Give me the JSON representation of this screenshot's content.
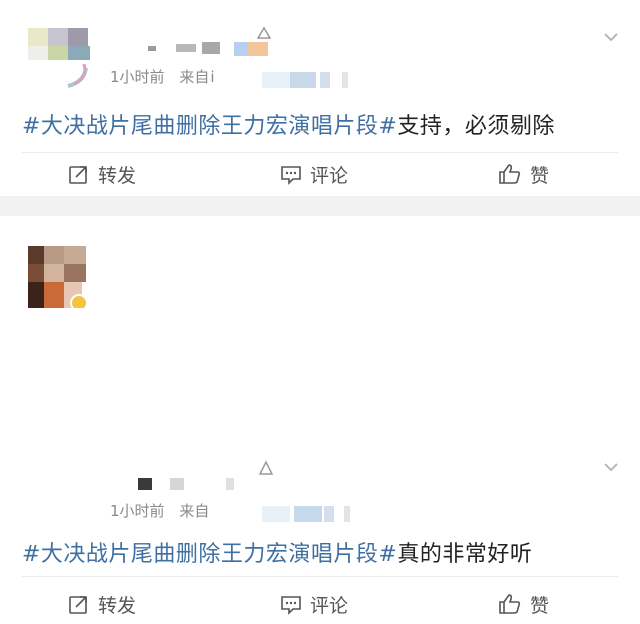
{
  "posts": [
    {
      "time": "1小时前",
      "source_label": "来自",
      "source_partial": "i",
      "topic": "#大决战片尾曲删除王力宏演唱片段#",
      "text": "支持，必须剔除",
      "actions": {
        "repost": "转发",
        "comment": "评论",
        "like": "赞"
      }
    },
    {
      "time": "1小时前",
      "source_label": "来自",
      "source_partial": "",
      "topic": "#大决战片尾曲删除王力宏演唱片段#",
      "text": "真的非常好听",
      "actions": {
        "repost": "转发",
        "comment": "评论",
        "like": "赞"
      }
    }
  ],
  "icons": {
    "more": "chevron-down-icon",
    "repost": "repost-icon",
    "comment": "comment-icon",
    "like": "thumbs-up-icon"
  },
  "colors": {
    "topic": "#3f6fa3",
    "meta": "#8a8a8a",
    "separator": "#f2f2f2"
  }
}
